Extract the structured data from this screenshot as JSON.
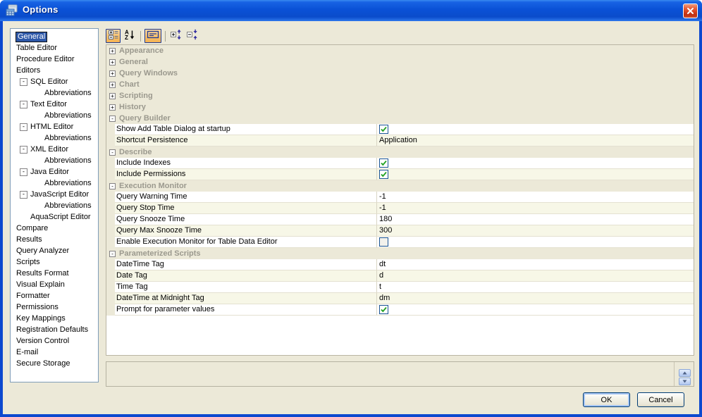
{
  "window": {
    "title": "Options"
  },
  "colors": {
    "titlebar_blue": "#0A51D6",
    "window_border_blue": "#0D49CF",
    "dialog_bg": "#ECE9D8",
    "selection_blue": "#2E58A8",
    "row_alt_cream": "#F7F7E7",
    "category_text_gray": "#9B998E",
    "checkbox_green": "#21A121",
    "pressed_button_orange": "#F7BE66",
    "pressed_button_border": "#1F3A93"
  },
  "sidebar": {
    "items": [
      {
        "label": "General",
        "level": 0,
        "selected": true
      },
      {
        "label": "Table Editor",
        "level": 0
      },
      {
        "label": "Procedure Editor",
        "level": 0
      },
      {
        "label": "Editors",
        "level": 0
      },
      {
        "label": "SQL Editor",
        "level": 1,
        "collapser": true
      },
      {
        "label": "Abbreviations",
        "level": 2
      },
      {
        "label": "Text Editor",
        "level": 1,
        "collapser": true
      },
      {
        "label": "Abbreviations",
        "level": 2
      },
      {
        "label": "HTML Editor",
        "level": 1,
        "collapser": true
      },
      {
        "label": "Abbreviations",
        "level": 2
      },
      {
        "label": "XML Editor",
        "level": 1,
        "collapser": true
      },
      {
        "label": "Abbreviations",
        "level": 2
      },
      {
        "label": "Java Editor",
        "level": 1,
        "collapser": true
      },
      {
        "label": "Abbreviations",
        "level": 2
      },
      {
        "label": "JavaScript Editor",
        "level": 1,
        "collapser": true
      },
      {
        "label": "Abbreviations",
        "level": 2
      },
      {
        "label": "AquaScript Editor",
        "level": 1
      },
      {
        "label": "Compare",
        "level": 0
      },
      {
        "label": "Results",
        "level": 0
      },
      {
        "label": "Query Analyzer",
        "level": 0
      },
      {
        "label": "Scripts",
        "level": 0
      },
      {
        "label": "Results Format",
        "level": 0
      },
      {
        "label": "Visual Explain",
        "level": 0
      },
      {
        "label": "Formatter",
        "level": 0
      },
      {
        "label": "Permissions",
        "level": 0
      },
      {
        "label": "Key Mappings",
        "level": 0
      },
      {
        "label": "Registration Defaults",
        "level": 0
      },
      {
        "label": "Version Control",
        "level": 0
      },
      {
        "label": "E-mail",
        "level": 0
      },
      {
        "label": "Secure Storage",
        "level": 0
      }
    ]
  },
  "toolbar": {
    "buttons": [
      {
        "name": "categorized",
        "pressed": true
      },
      {
        "name": "sort-alphabetical",
        "pressed": false
      },
      {
        "name": "description-pane",
        "pressed": true
      },
      {
        "name": "expand-all",
        "pressed": false
      },
      {
        "name": "collapse-all",
        "pressed": false
      }
    ]
  },
  "grid": {
    "rows": [
      {
        "type": "category",
        "label": "Appearance",
        "expanded": false
      },
      {
        "type": "category",
        "label": "General",
        "expanded": false
      },
      {
        "type": "category",
        "label": "Query Windows",
        "expanded": false
      },
      {
        "type": "category",
        "label": "Chart",
        "expanded": false
      },
      {
        "type": "category",
        "label": "Scripting",
        "expanded": false
      },
      {
        "type": "category",
        "label": "History",
        "expanded": false
      },
      {
        "type": "category",
        "label": "Query Builder",
        "expanded": true
      },
      {
        "type": "item",
        "label": "Show Add Table Dialog at startup",
        "control": "checkbox",
        "checked": true
      },
      {
        "type": "item",
        "label": "Shortcut Persistence",
        "control": "text",
        "value": "Application"
      },
      {
        "type": "category",
        "label": "Describe",
        "expanded": true
      },
      {
        "type": "item",
        "label": "Include Indexes",
        "control": "checkbox",
        "checked": true
      },
      {
        "type": "item",
        "label": "Include Permissions",
        "control": "checkbox",
        "checked": true
      },
      {
        "type": "category",
        "label": "Execution Monitor",
        "expanded": true
      },
      {
        "type": "item",
        "label": "Query Warning Time",
        "control": "text",
        "value": "-1"
      },
      {
        "type": "item",
        "label": "Query Stop Time",
        "control": "text",
        "value": "-1"
      },
      {
        "type": "item",
        "label": "Query Snooze Time",
        "control": "text",
        "value": "180"
      },
      {
        "type": "item",
        "label": "Query Max Snooze Time",
        "control": "text",
        "value": "300"
      },
      {
        "type": "item",
        "label": "Enable Execution Monitor for Table Data Editor",
        "control": "checkbox",
        "checked": false
      },
      {
        "type": "category",
        "label": "Parameterized Scripts",
        "expanded": true
      },
      {
        "type": "item",
        "label": "DateTime Tag",
        "control": "text",
        "value": "dt"
      },
      {
        "type": "item",
        "label": "Date Tag",
        "control": "text",
        "value": "d"
      },
      {
        "type": "item",
        "label": "Time Tag",
        "control": "text",
        "value": "t"
      },
      {
        "type": "item",
        "label": "DateTime at Midnight Tag",
        "control": "text",
        "value": "dm"
      },
      {
        "type": "item",
        "label": "Prompt for parameter values",
        "control": "checkbox",
        "checked": true
      }
    ]
  },
  "description_panel": {
    "text": ""
  },
  "footer": {
    "ok_label": "OK",
    "cancel_label": "Cancel"
  }
}
